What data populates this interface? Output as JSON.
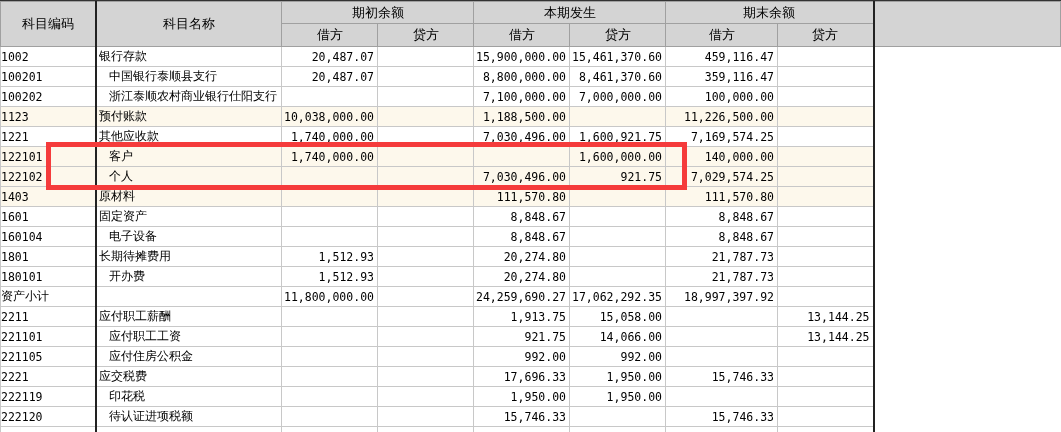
{
  "table": {
    "columns": [
      {
        "label": "科目编码"
      },
      {
        "label": "科目名称"
      }
    ],
    "column_groups": [
      {
        "label": "期初余额",
        "subcolumns": [
          "借方",
          "贷方"
        ]
      },
      {
        "label": "本期发生",
        "subcolumns": [
          "借方",
          "贷方"
        ]
      },
      {
        "label": "期末余额",
        "subcolumns": [
          "借方",
          "贷方"
        ]
      }
    ],
    "rows": [
      {
        "code": "1002",
        "name": "银行存款",
        "highlighted": false,
        "framed": false,
        "opening_debit": "20,487.07",
        "period_debit": "15,900,000.00",
        "period_credit": "15,461,370.60",
        "closing_debit": "459,116.47",
        "children": [
          {
            "code": "100201",
            "name": "中国银行泰顺县支行",
            "highlighted": false,
            "framed": false,
            "opening_debit": "20,487.07",
            "period_debit": "8,800,000.00",
            "period_credit": "8,461,370.60",
            "closing_debit": "359,116.47"
          },
          {
            "code": "100202",
            "name": "浙江泰顺农村商业银行仕阳支行",
            "highlighted": false,
            "framed": false,
            "period_debit": "7,100,000.00",
            "period_credit": "7,000,000.00",
            "closing_debit": "100,000.00"
          }
        ]
      },
      {
        "code": "1123",
        "name": "预付账款",
        "highlighted": true,
        "framed": false,
        "opening_debit": "10,038,000.00",
        "period_debit": "1,188,500.00",
        "closing_debit": "11,226,500.00"
      },
      {
        "code": "1221",
        "name": "其他应收款",
        "highlighted": false,
        "framed": false,
        "opening_debit": "1,740,000.00",
        "period_debit": "7,030,496.00",
        "period_credit": "1,600,921.75",
        "closing_debit": "7,169,574.25",
        "children": [
          {
            "code": "122101",
            "name": "客户",
            "highlighted": true,
            "framed": true,
            "opening_debit": "1,740,000.00",
            "period_credit": "1,600,000.00",
            "closing_debit": "140,000.00"
          },
          {
            "code": "122102",
            "name": "个人",
            "highlighted": true,
            "framed": true,
            "period_debit": "7,030,496.00",
            "period_credit": "921.75",
            "closing_debit": "7,029,574.25"
          }
        ]
      },
      {
        "code": "1403",
        "name": "原材料",
        "highlighted": true,
        "framed": false,
        "period_debit": "111,570.80",
        "closing_debit": "111,570.80"
      },
      {
        "code": "1601",
        "name": "固定资产",
        "highlighted": false,
        "framed": false,
        "period_debit": "8,848.67",
        "closing_debit": "8,848.67",
        "children": [
          {
            "code": "160104",
            "name": "电子设备",
            "highlighted": false,
            "framed": false,
            "period_debit": "8,848.67",
            "closing_debit": "8,848.67"
          }
        ]
      },
      {
        "code": "1801",
        "name": "长期待摊费用",
        "highlighted": false,
        "framed": false,
        "opening_debit": "1,512.93",
        "period_debit": "20,274.80",
        "closing_debit": "21,787.73",
        "children": [
          {
            "code": "180101",
            "name": "开办费",
            "highlighted": false,
            "framed": false,
            "opening_debit": "1,512.93",
            "period_debit": "20,274.80",
            "closing_debit": "21,787.73"
          }
        ]
      },
      {
        "code": "资产小计",
        "highlighted": false,
        "framed": false,
        "opening_debit": "11,800,000.00",
        "period_debit": "24,259,690.27",
        "period_credit": "17,062,292.35",
        "closing_debit": "18,997,397.92"
      },
      {
        "code": "2211",
        "name": "应付职工薪酬",
        "highlighted": false,
        "framed": false,
        "period_debit": "1,913.75",
        "period_credit": "15,058.00",
        "closing_credit": "13,144.25",
        "children": [
          {
            "code": "221101",
            "name": "应付职工工资",
            "highlighted": false,
            "framed": false,
            "period_debit": "921.75",
            "period_credit": "14,066.00",
            "closing_credit": "13,144.25"
          },
          {
            "code": "221105",
            "name": "应付住房公积金",
            "highlighted": false,
            "framed": false,
            "period_debit": "992.00",
            "period_credit": "992.00"
          }
        ]
      },
      {
        "code": "2221",
        "name": "应交税费",
        "highlighted": false,
        "framed": false,
        "period_debit": "17,696.33",
        "period_credit": "1,950.00",
        "closing_debit": "15,746.33",
        "children": [
          {
            "code": "222119",
            "name": "印花税",
            "highlighted": false,
            "framed": false,
            "period_debit": "1,950.00",
            "period_credit": "1,950.00"
          },
          {
            "code": "222120",
            "name": "待认证进项税额",
            "highlighted": false,
            "framed": false,
            "period_debit": "15,746.33",
            "closing_debit": "15,746.33"
          }
        ]
      }
    ]
  }
}
